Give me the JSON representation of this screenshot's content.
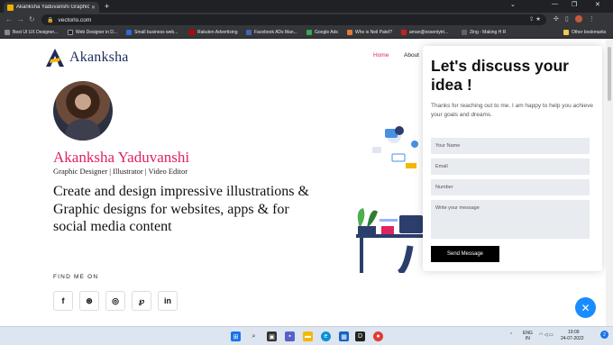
{
  "browser": {
    "tab_title": "Akanksha Yaduvanshi Graphic De",
    "url": "vectorlo.com",
    "bookmarks": [
      "Best UI UX Designer...",
      "Web Designer in D...",
      "Small business web...",
      "Rakuten Advertising",
      "Facebook ADs Man...",
      "Google Ads",
      "Who is Neil Patel?",
      "aman@essentytri...",
      "Zing - Making H R",
      "Other bookmarks"
    ]
  },
  "site": {
    "logo_text": "Akanksha",
    "nav": {
      "home": "Home",
      "about": "About"
    },
    "name": "Akanksha Yaduvanshi",
    "roles": "Graphic Designer | Illustrator | Video Editor",
    "headline": "Create and design impressive illustrations & Graphic designs for websites, apps & for social media content",
    "find_me": "FIND ME ON",
    "socials": [
      {
        "icon": "facebook-icon",
        "glyph": "f"
      },
      {
        "icon": "dribbble-icon",
        "glyph": "⊛"
      },
      {
        "icon": "instagram-icon",
        "glyph": "◎"
      },
      {
        "icon": "pinterest-icon",
        "glyph": "℘"
      },
      {
        "icon": "linkedin-icon",
        "glyph": "in"
      }
    ]
  },
  "contact": {
    "title": "Let's discuss your idea !",
    "subtitle": "Thanks for reaching out to me. I am happy to help you achieve your goals and dreams.",
    "name_placeholder": "Your Name",
    "email_placeholder": "Email",
    "number_placeholder": "Number",
    "message_placeholder": "Write your message",
    "send_label": "Send Message"
  },
  "taskbar": {
    "language": "ENG\nIN",
    "time": "19:09",
    "date": "24-07-2022",
    "notification_count": "2"
  },
  "colors": {
    "accent": "#e0245e",
    "brand_navy": "#1f2a5a",
    "fab_blue": "#1a8cff"
  }
}
